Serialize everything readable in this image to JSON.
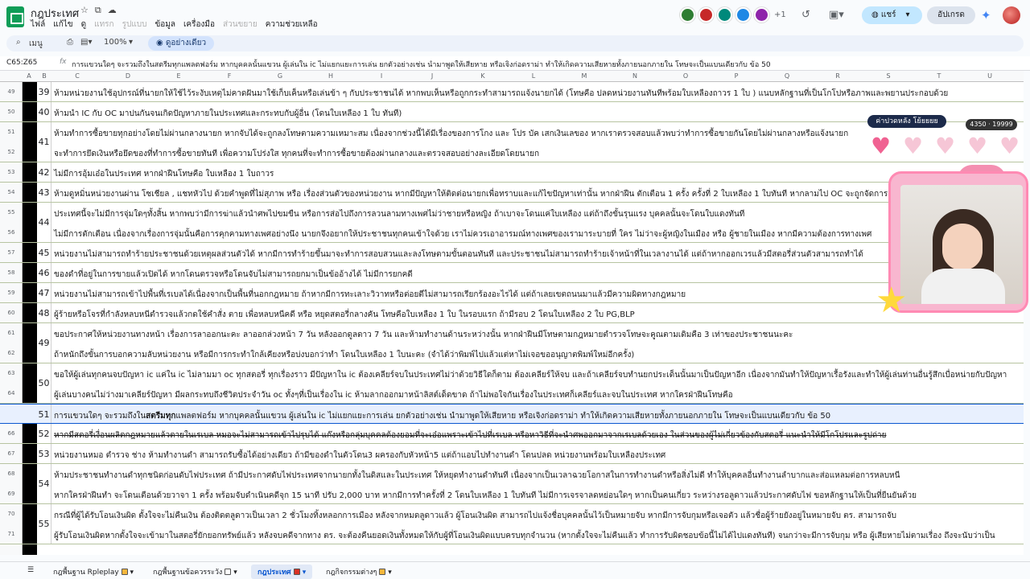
{
  "app": {
    "title": "กฎประเทศ",
    "menu": [
      "ไฟล์",
      "แก้ไข",
      "ดู",
      "แทรก",
      "รูปแบบ",
      "ข้อมูล",
      "เครื่องมือ",
      "ส่วนขยาย",
      "ความช่วยเหลือ"
    ],
    "menu_disabled": [
      false,
      false,
      false,
      true,
      true,
      false,
      false,
      true,
      false
    ],
    "collaborators_extra": "+1",
    "share_label": "แชร์",
    "update_label": "อัปเกรด"
  },
  "toolbar": {
    "search_label": "เมนู",
    "zoom": "100%",
    "view_only_label": "ดูอย่างเดียว"
  },
  "formula_bar": {
    "cell_ref": "C65:Z65",
    "content": "การแขวนใดๆ จะรวมถึงในสตรีมทุกแพลตฟอร์ม หากบุคคลนั้นแขวน ผู้เล่นใน ic ไม่แยกแยะการเล่น ยกตัวอย่างเช่น นำมาพูดให้เสียหาย หรือเจิงก่อดราม่า ทำให้เกิดความเสียหายทั้งภายนอกภายใน โทษจะเป็นแบนเดียวกับ ข้อ 50"
  },
  "columns": [
    "A",
    "B",
    "C",
    "D",
    "E",
    "F",
    "G",
    "H",
    "I",
    "J",
    "K",
    "L",
    "M",
    "N",
    "O",
    "P",
    "Q",
    "R",
    "S",
    "T",
    "U"
  ],
  "row_numbers": [
    "49",
    "50",
    "51",
    "52",
    "53",
    "54",
    "55",
    "56",
    "57",
    "58",
    "59",
    "60",
    "61",
    "62",
    "63",
    "64",
    "65",
    "66",
    "67",
    "68",
    "69",
    "70",
    "71"
  ],
  "rules": [
    {
      "num": "39",
      "lines": [
        "ห้ามหน่วยงานใช้อุปกรณ์ที่นายกให้ใช้ไว้ระงับเหตุไม่คาดฝันมาใช้เก็บเค็นหรือเล่นข้า ๆ กับประชาชนได้ หากพบเห็นหรือถูกกระทำสามารถแจ้งนายกได้ (โทษคือ ปลดหน่วยงานทันทีพร้อมใบเหลืองถาวร 1 ใบ ) แนบหลักฐานที่เป็นโกโปหรือภาพและพยานประกอบด้วย"
      ]
    },
    {
      "num": "40",
      "lines": [
        "ห้ามนำ IC กับ OC มาปนกันจนเกิดปัญหาภายในประเทศและกระทบกับผู้อื่น (โดนใบเหลือง 1 ใบ ทันที)"
      ]
    },
    {
      "num": "41",
      "lines": [
        "ห้ามทำการซื้อขายทุกอย่างโดยไม่ผ่านกลางนายก หากจับได้จะถูกลงโทษตามความเหมาะสม เนื่องจากช่วงนี้ได้มีเรื่องของการโกง และ โปร บัค เสกเงินเลของ หากเราตรวจสอบแล้วพบว่าทำการซื้อขายกันโดยไม่ผ่านกลางหรือแจ้งนายก",
        "จะทำการยึดเงินหรือยึดของที่ทำการซื้อขายทันที เพื่อความโปร่งใส ทุกคนที่จะทำการซื้อขายต้องผ่านกลางและตรวจสอบอย่างละเอียดโดยนายก"
      ]
    },
    {
      "num": "42",
      "lines": [
        "ไม่มีการอุ้มเอ๋อในประเทศ หากฝ่าฝืนโทษคือ ใบเหลือง 1 ใบถาวร"
      ]
    },
    {
      "num": "43",
      "lines": [
        "ห้ามดูหมิ่นหน่วยงานผ่าน โซเชียล , แชทหัวไป ด้วยคำพูดที่ไม่สุภาพ หรือ เรื่องส่วนตัวของหน่วยงาน หากมีปัญหาให้ติดต่อนายกเพื่อทราบและแก้ไขปัญหาเท่านั้น หากฝ่าฝืน ตักเตือน 1 ครั้ง ครั้งที่ 2 ใบเหลือง 1 ใบทันที หากลามไป OC จะถูกจัดการ"
      ]
    },
    {
      "num": "44",
      "lines": [
        "ประเทศนี้จะไม่มีการจุ่มใดๆทั้งสิ้น หากพบว่ามีการฆ่าแล้วนำศพไปขมขืน หรือการส่อไปถึงการลวนลามทางเพศไม่ว่าชายหรือหญิง ถ้าเบาจะโดนแค่ใบเหลือง แต่ถ้าถึงขั้นรุนแรง บุคคลนั้นจะโดนใบแดงทันที",
        "ไม่มีการตักเตือน เนื่องจากเรื่องการจุ่มนั้นคือการคุกคามทางเพศอย่างนึง นายกจึงอยากให้ประชาชนทุกคนเข้าใจด้วย เราไม่ควรเอาอารมณ์ทางเพศของเรามาระบายที่ ใคร ไม่ว่าจะผู้หญิงในเมือง หรือ ผู้ชายในเมือง หากมีความต้องการทางเพศ"
      ]
    },
    {
      "num": "45",
      "lines": [
        "หน่วยงานไม่สามารถทำร้ายประชาชนด้วยเหตุผลส่วนตัวได้ หากมีการทำร้ายขึ้นมาจะทำการสอบสวนและลงโทษตามขั้นตอนทันที และประชาชนไม่สามารถทำร้ายเจ้าหน้าที่ในเวลางานได้ แต่ถ้าหากออกเวรแล้วมีสตอรี่ส่วนตัวสามารถทำได้"
      ]
    },
    {
      "num": "46",
      "lines": [
        "ของดำที่อยู่ในการขายแล้วเปิดได้ หากโดนตรวจหรือโดนจับไม่สามารถยกมาเป็นข้ออ้างได้ ไม่มีการยกคดี"
      ]
    },
    {
      "num": "47",
      "lines": [
        "หน่วยงานไม่สามารถเข้าไปพื้นที่เรเบลได้เนื่องจากเป็นพื้นที่นอกกฎหมาย ถ้าหากมีการทะเลาะวิวาทหรือต่อยตีไม่สามารถเรียกร้องอะไรได้ แต่ถ้าเลยเขตถนนมาแล้วมีความผิดทางกฎหมาย"
      ]
    },
    {
      "num": "48",
      "lines": [
        "ผู้ร้ายหรือโจรที่กำลังหลบหนีตำรวจแล้วกดใช้คำสั่ง ตาย เพื่อหลบหนีคดี หรือ หยุดสตอรี่กลางคัน โทษคือใบเหลือง 1 ใบ ในรอบแรก ถ้ามีรอบ 2 โดนใบเหลือง 2 ใบ PG,BLP"
      ]
    },
    {
      "num": "49",
      "lines": [
        "ขอประกาศให้หน่วยงานทางหน้า เรื่องการลาออกนะคะ ลาออกล่วงหน้า 7 วัน หลังออกดูลดาว 7 วัน และห้ามทำงานด้านระหว่างนั้น หากฝ่าฝืนมีโทษตามกฎหมายตำรวจโทษจะคูณตามเดิมคือ 3 เท่าของประชาชนนะคะ",
        "ถ้าหนักถึงขั้นการบอกความลับหน่วยงาน หรือมีการกระทำใกล้เคียงหรือบ่งบอกว่าทำ โดนใบเหลือง 1 ใบนะคะ (จำได้ว่าพิมพ์ไปแล้วแต่หาไม่เจอขออนุญาตพิมพ์ใหม่อีกครั้ง)"
      ]
    },
    {
      "num": "50",
      "lines": [
        "ขอให้ผู้เล่นทุกคนจบปัญหา ic แค่ใน ic ไม่ลามมา oc ทุกสตอรี่ ทุกเรื่องราว มีปัญหาใน ic ต้องเคลียร์จบในประเทศไม่ว่าด้วยวิธีใดก็ตาม ต้องเคลียร์ให้จบ และถ้าเคลียร์จบทำนยกประเด็นนั้นมาเป็นปัญหาอีก เนื่องจากมันทำให้ปัญหาเรื้อรังและทำให้ผู้เล่นท่านอื่นรู้สึกเบื่อหน่ายกับปัญหา",
        "ผู้เล่นบางคนไม่ว่างมาเคลียร์ปัญหา มีผลกระทบถึงชีวิตประจำวัน oc ทั้งๆที่เป็นเรื่องใน ic ห้ามลากออกมาหน้าลิสต์เด็ดขาด ถ้าไม่พอใจกันเรื่องในประเทศก็เคลียร์และจบในประเทศ หากใครฝ่าฝืนโทษคือ "
      ]
    },
    {
      "num": "51",
      "lines": [
        "การแขวนใดๆ จะรวมถึงในสตรีมทุกแพลตฟอร์ม หากบุคคลนั้นแขวน ผู้เล่นใน ic ไม่แยกแยะการเล่น ยกตัวอย่างเช่น นำมาพูดให้เสียหาย หรือเจิงก่อดราม่า ทำให้เกิดความเสียหายทั้งภายนอกภายใน โทษจะเป็นแบนเดียวกับ ข้อ 50"
      ]
    },
    {
      "num": "52",
      "lines": [
        "หากมีสตอรี่เงื่อนผลิตกฎหมายแล้วตายในเรเบล หมอจะไม่สามารถเข้าไปรุบได้ แก๊งหรือกลุ่มบุคคลต้องยอมที่จะเอ๋อแพราะเข้าไปที่เรเบล หรือหาวิธีที่จะนำศพออกมาจากเรเบลด้วยเอง ในส่วนของผู้ไม่เกี่ยวข้องกับสตอรี่ แนะนำให้มีโกโปรและรูปถ่าย"
      ]
    },
    {
      "num": "53",
      "lines": [
        "หน่วยงานหมอ ตำรวจ ช่าง ห้ามทำงานดำ สามารถรับซื้อได้อย่างเดียว ถ้ามีของดำในตัวโดน3 ผครองกับหัวหน้า5 แต่ถ้าแอบไปทำงานดำ โดนปลด หน่วยงานพร้อมใบเหลืองประเทศ"
      ]
    },
    {
      "num": "54",
      "lines": [
        "ห้ามประชาชนทำงานดำทุกชนิดก่อนดับไฟประเทศ ถ้ามีประกาศดับไฟประเทศจากนายกทั้งในดิสและในประเทศ ให้หยุดทำงานดำทันที เนื่องจากเป็นเวลาฉวยโอกาสในการทำงานดำหรือสิ่งไม่ดี ทำให้บุคคลอื่นทำงานลำบากและส่อแหลมต่อการหลบหนี",
        "หากใครฝ่าฝืนทำ จะโดนเตือนด้วยวาจา 1 ครั้ง พร้อมจับดำเนินคดีจุก 15 นาที ปรับ 2,000 บาท หากมีการทำครั้งที่ 2 โดนใบเหลือง 1 ใบทันที ไม่มีการเจรจาลดหย่อนใดๆ หากเป็นคนเกี่ยว ระหว่างรอลูดาวแล้วประกาศดับไฟ ขอหลักฐานให้เป็นที่ยืนยันด้วย"
      ]
    },
    {
      "num": "55",
      "lines": [
        "กรณีที่ผู้ได้รับโอนเงินผิด ตั้งใจจะไม่คืนเงิน ต้องติดตลูดาวเป็นเวลา 2 ชั่วโมงทิ้งหลอกการเมือง หลังจากหมดลูดาวแล้ว ผู้โอนเงินผิด สามารถไปแจ้งชื่อบุคคลนั้นไว้เป็นหมายจับ หากมีการจับกุมหรือเจอตัว แล้วชื่อผู้ร้ายยังอยู่ในหมายจับ ตร. สามารถจับ",
        "ผู้รับโอนเงินผิดหากตั้งใจจะเข้ามาในสตอรี่ยักยอกทรัพย์แล้ว หลังจบคดีจากทาง ตร. จะต้องคืนยอดเงินทั้งหมดให้กับผู้ที่โอนเงินผิดแบบครบทุกจำนวน (หากตั้งใจจะไม่คืนแล้ว ทำการรับผิดชอบข้อนี้ไม่ได้ไปแดงทันที) จนกว่าจะมีการจับกุม หรือ ผู้เสียหายไม่ตามเรื่อง ถึงจะนับว่าเป็น"
      ]
    }
  ],
  "rule50_red": "ใบแดงถาวร",
  "rule50_tail": " การนำไปโพสใดๆ หรือการก่อดราม่า ทำให้เกิดความเสียหาย โซเชียล",
  "rule51_bold": "สตรีมทุก",
  "overlay": {
    "pill_label": "ค่าปวดหลัง โย้ยยยย",
    "counter": "4350 · 19999",
    "hearts_total": 5,
    "hearts_filled": 1
  },
  "sheet_tabs": [
    {
      "label": "กฎพื้นฐาน Rpleplay",
      "color": "#f6b73c",
      "active": false
    },
    {
      "label": "กฎพื้นฐานข้อควรระวัง",
      "color": "#ffffff",
      "active": false
    },
    {
      "label": "กฎประเทศ",
      "color": "#d93025",
      "active": true
    },
    {
      "label": "กฎกิจกรรมต่างๆ",
      "color": "#f6b73c",
      "active": false
    }
  ],
  "colors": {
    "accent": "#0b57d0",
    "sheets_green": "#0f9d58",
    "heart_full": "#f06292",
    "heart_empty": "#f6c6d6"
  }
}
